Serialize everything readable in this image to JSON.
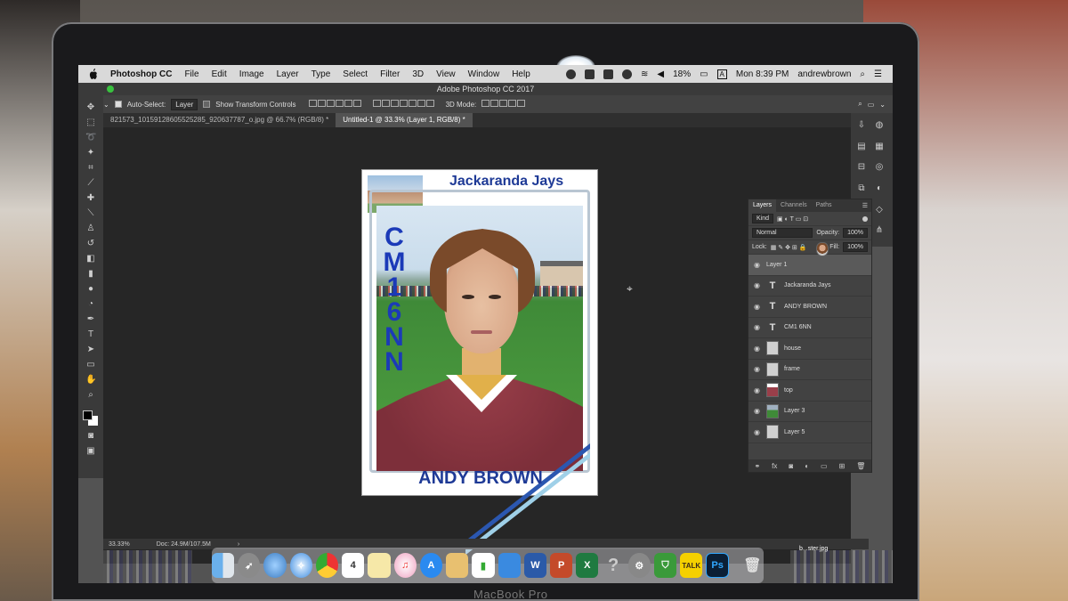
{
  "menubar": {
    "app": "Photoshop CC",
    "items": [
      "File",
      "Edit",
      "Image",
      "Layer",
      "Type",
      "Select",
      "Filter",
      "3D",
      "View",
      "Window",
      "Help"
    ],
    "battery": "18%",
    "input_source": "A",
    "clock": "Mon 8:39 PM",
    "user": "andrewbrown"
  },
  "window": {
    "title": "Adobe Photoshop CC 2017"
  },
  "options": {
    "auto_select_label": "Auto-Select:",
    "auto_select_value": "Layer",
    "transform_label": "Show Transform Controls",
    "mode_3d_label": "3D Mode:"
  },
  "tabs": [
    {
      "label": "821573_10159128605525285_920637787_o.jpg @ 66.7% (RGB/8) *"
    },
    {
      "label": "Untitled-1 @ 33.3% (Layer 1, RGB/8) *"
    }
  ],
  "card": {
    "team": "Jackaranda Jays",
    "postcode_chars": [
      "C",
      "M",
      "1",
      "6",
      "N",
      "N"
    ],
    "name": "ANDY BROWN"
  },
  "layers_panel": {
    "tabs": [
      "Layers",
      "Channels",
      "Paths"
    ],
    "filter_label": "Kind",
    "blend_mode": "Normal",
    "opacity_label": "Opacity:",
    "opacity_value": "100%",
    "lock_label": "Lock:",
    "fill_label": "Fill:",
    "fill_value": "100%",
    "layers": [
      {
        "name": "Layer 1",
        "kind": "image-face",
        "selected": true
      },
      {
        "name": "Jackaranda Jays",
        "kind": "text"
      },
      {
        "name": "ANDY BROWN",
        "kind": "text"
      },
      {
        "name": "CM1 6NN",
        "kind": "text"
      },
      {
        "name": "house",
        "kind": "image"
      },
      {
        "name": "frame",
        "kind": "image"
      },
      {
        "name": "top",
        "kind": "image-top"
      },
      {
        "name": "Layer 3",
        "kind": "image-field"
      },
      {
        "name": "Layer 5",
        "kind": "image"
      }
    ]
  },
  "status": {
    "zoom": "33.33%",
    "doc": "Doc: 24.9M/107.5M"
  },
  "dock": {
    "calendar_day": "4",
    "kakao_label": "TALK",
    "ps_label": "Ps",
    "word_label": "W",
    "powerpoint_label": "P",
    "excel_label": "X",
    "help_label": "?"
  },
  "desktop": {
    "file_label": "b...ster.jpg"
  },
  "device_label": "MacBook Pro",
  "colors": {
    "card_blue": "#1e3a96",
    "postcode_blue": "#1b3ab8",
    "ps_dark": "#262626"
  }
}
